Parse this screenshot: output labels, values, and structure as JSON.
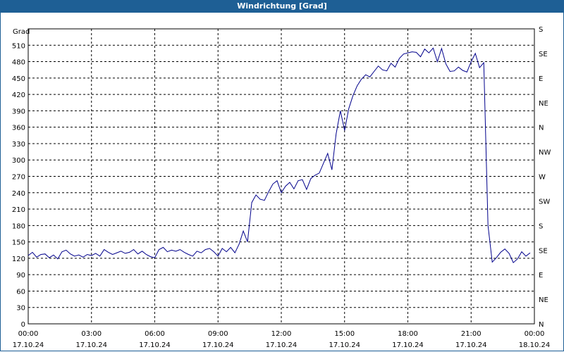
{
  "window": {
    "title": "Windrichtung [Grad]"
  },
  "chart_data": {
    "type": "line",
    "title": "Windrichtung [Grad]",
    "ylabel": "Grad",
    "xlabel": "",
    "ylim": [
      0,
      540
    ],
    "y_ticks": [
      0,
      30,
      60,
      90,
      120,
      150,
      180,
      210,
      240,
      270,
      300,
      330,
      360,
      390,
      420,
      450,
      480,
      510
    ],
    "x_range_hours": [
      0,
      24
    ],
    "x_ticks": [
      {
        "time": "00:00",
        "date": "17.10.24"
      },
      {
        "time": "03:00",
        "date": "17.10.24"
      },
      {
        "time": "06:00",
        "date": "17.10.24"
      },
      {
        "time": "09:00",
        "date": "17.10.24"
      },
      {
        "time": "12:00",
        "date": "17.10.24"
      },
      {
        "time": "15:00",
        "date": "17.10.24"
      },
      {
        "time": "18:00",
        "date": "17.10.24"
      },
      {
        "time": "21:00",
        "date": "17.10.24"
      },
      {
        "time": "00:00",
        "date": "18.10.24"
      }
    ],
    "right_axis": {
      "labels": [
        "N",
        "NE",
        "E",
        "SE",
        "S",
        "SW",
        "W",
        "NW",
        "N",
        "NE",
        "E",
        "SE",
        "S"
      ],
      "values": [
        0,
        45,
        90,
        135,
        180,
        225,
        270,
        315,
        360,
        405,
        450,
        495,
        540
      ]
    },
    "grid": true,
    "line_color": "#00008b",
    "series": [
      {
        "name": "",
        "x": [
          0,
          0.2,
          0.4,
          0.6,
          0.8,
          1.0,
          1.2,
          1.4,
          1.6,
          1.8,
          2.0,
          2.2,
          2.4,
          2.6,
          2.8,
          3.0,
          3.2,
          3.4,
          3.6,
          3.8,
          4.0,
          4.2,
          4.4,
          4.6,
          4.8,
          5.0,
          5.2,
          5.4,
          5.6,
          5.8,
          6.0,
          6.2,
          6.4,
          6.6,
          6.8,
          7.0,
          7.2,
          7.4,
          7.6,
          7.8,
          8.0,
          8.2,
          8.4,
          8.6,
          8.8,
          9.0,
          9.2,
          9.4,
          9.6,
          9.8,
          10.0,
          10.2,
          10.4,
          10.6,
          10.8,
          11.0,
          11.2,
          11.4,
          11.6,
          11.8,
          12.0,
          12.2,
          12.4,
          12.6,
          12.8,
          13.0,
          13.2,
          13.4,
          13.6,
          13.8,
          14.0,
          14.2,
          14.4,
          14.6,
          14.8,
          15.0,
          15.2,
          15.4,
          15.6,
          15.8,
          16.0,
          16.2,
          16.4,
          16.6,
          16.8,
          17.0,
          17.2,
          17.4,
          17.6,
          17.8,
          18.0,
          18.2,
          18.4,
          18.6,
          18.8,
          19.0,
          19.2,
          19.4,
          19.6,
          19.8,
          20.0,
          20.2,
          20.4,
          20.6,
          20.8,
          21.0,
          21.2,
          21.4,
          21.6,
          21.8,
          22.0,
          22.2,
          22.4,
          22.6,
          22.8,
          23.0,
          23.2,
          23.4,
          23.6,
          23.8
        ],
        "values": [
          125,
          131,
          122,
          127,
          128,
          121,
          126,
          119,
          132,
          135,
          128,
          124,
          126,
          122,
          127,
          125,
          129,
          124,
          136,
          131,
          127,
          130,
          133,
          129,
          131,
          136,
          128,
          133,
          127,
          123,
          121,
          136,
          140,
          132,
          135,
          133,
          136,
          131,
          127,
          124,
          133,
          130,
          136,
          138,
          132,
          124,
          138,
          132,
          140,
          130,
          146,
          170,
          150,
          222,
          236,
          228,
          226,
          242,
          256,
          262,
          240,
          252,
          259,
          247,
          262,
          264,
          246,
          266,
          272,
          276,
          294,
          312,
          282,
          348,
          390,
          354,
          394,
          418,
          436,
          448,
          456,
          452,
          462,
          472,
          465,
          463,
          477,
          470,
          486,
          494,
          496,
          498,
          497,
          489,
          503,
          496,
          505,
          480,
          504,
          476,
          462,
          463,
          470,
          464,
          461,
          480,
          495,
          469,
          478,
          180,
          113,
          121,
          131,
          137,
          129,
          112,
          119,
          132,
          124,
          130
        ]
      }
    ]
  }
}
